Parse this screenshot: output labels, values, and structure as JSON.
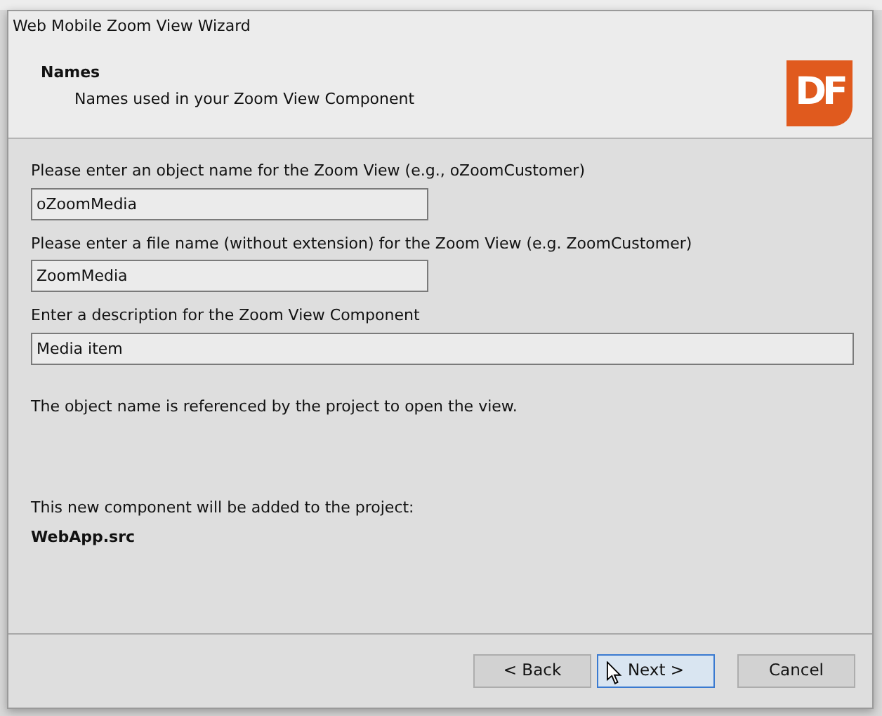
{
  "window": {
    "title": "Web Mobile Zoom View Wizard"
  },
  "header": {
    "title": "Names",
    "subtitle": "Names used in your Zoom View Component",
    "logo": "DF"
  },
  "fields": [
    {
      "label": "Please enter an object name for the Zoom View (e.g., oZoomCustomer)",
      "value": "oZoomMedia",
      "kind": "short"
    },
    {
      "label": "Please enter a file name (without extension) for the Zoom View (e.g. ZoomCustomer)",
      "value": "ZoomMedia",
      "kind": "short"
    },
    {
      "label": "Enter a description for the Zoom View Component",
      "value": "Media item",
      "kind": "wide"
    }
  ],
  "note": "The object name is referenced by the project to open the view.",
  "project": {
    "label": "This new component will be added to the project:",
    "name": "WebApp.src"
  },
  "buttons": [
    {
      "label": "< Back",
      "focused": false
    },
    {
      "label": "Next >",
      "focused": true
    },
    {
      "label": "Cancel",
      "focused": false
    }
  ]
}
